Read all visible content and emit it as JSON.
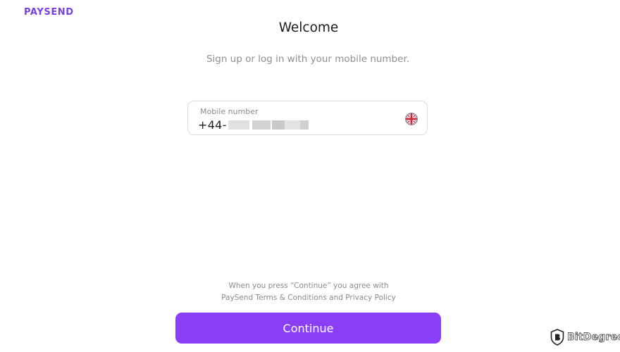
{
  "brand": {
    "logo_text": "PAYSEND",
    "accent_color": "#8a3ff7",
    "logo_color": "#7b3fe4"
  },
  "header": {
    "title": "Welcome",
    "subtitle": "Sign up or log in with your mobile number."
  },
  "phone_field": {
    "label": "Mobile number",
    "prefix": "+44-",
    "number_masked": true,
    "country_flag_icon": "uk-flag-icon"
  },
  "terms": {
    "line1": "When you press “Continue” you agree with",
    "line2": "PaySend Terms & Conditions and Privacy Policy"
  },
  "actions": {
    "continue_label": "Continue"
  },
  "watermark": {
    "text": "BitDegree",
    "icon": "bitdegree-shield-icon"
  }
}
